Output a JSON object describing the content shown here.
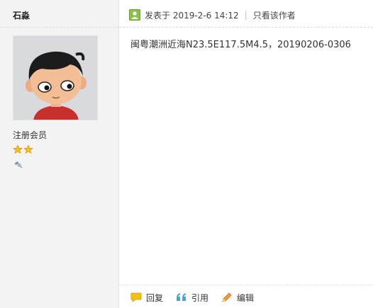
{
  "author": {
    "name": "石淼",
    "group": "注册会员",
    "star_color": "#f2b705",
    "avatar_icon": "cartoon-boy-avatar",
    "medal_icon": "satellite-medal-icon"
  },
  "post": {
    "posted_label": "发表于 2019-2-6 14:12",
    "separator": "|",
    "only_author_label": "只看该作者",
    "message": "闽粤潮洲近海N23.5E117.5M4.5，20190206-0306",
    "online_icon_color": "#8bc34a"
  },
  "actions": {
    "reply_label": "回复",
    "quote_label": "引用",
    "edit_label": "编辑"
  }
}
